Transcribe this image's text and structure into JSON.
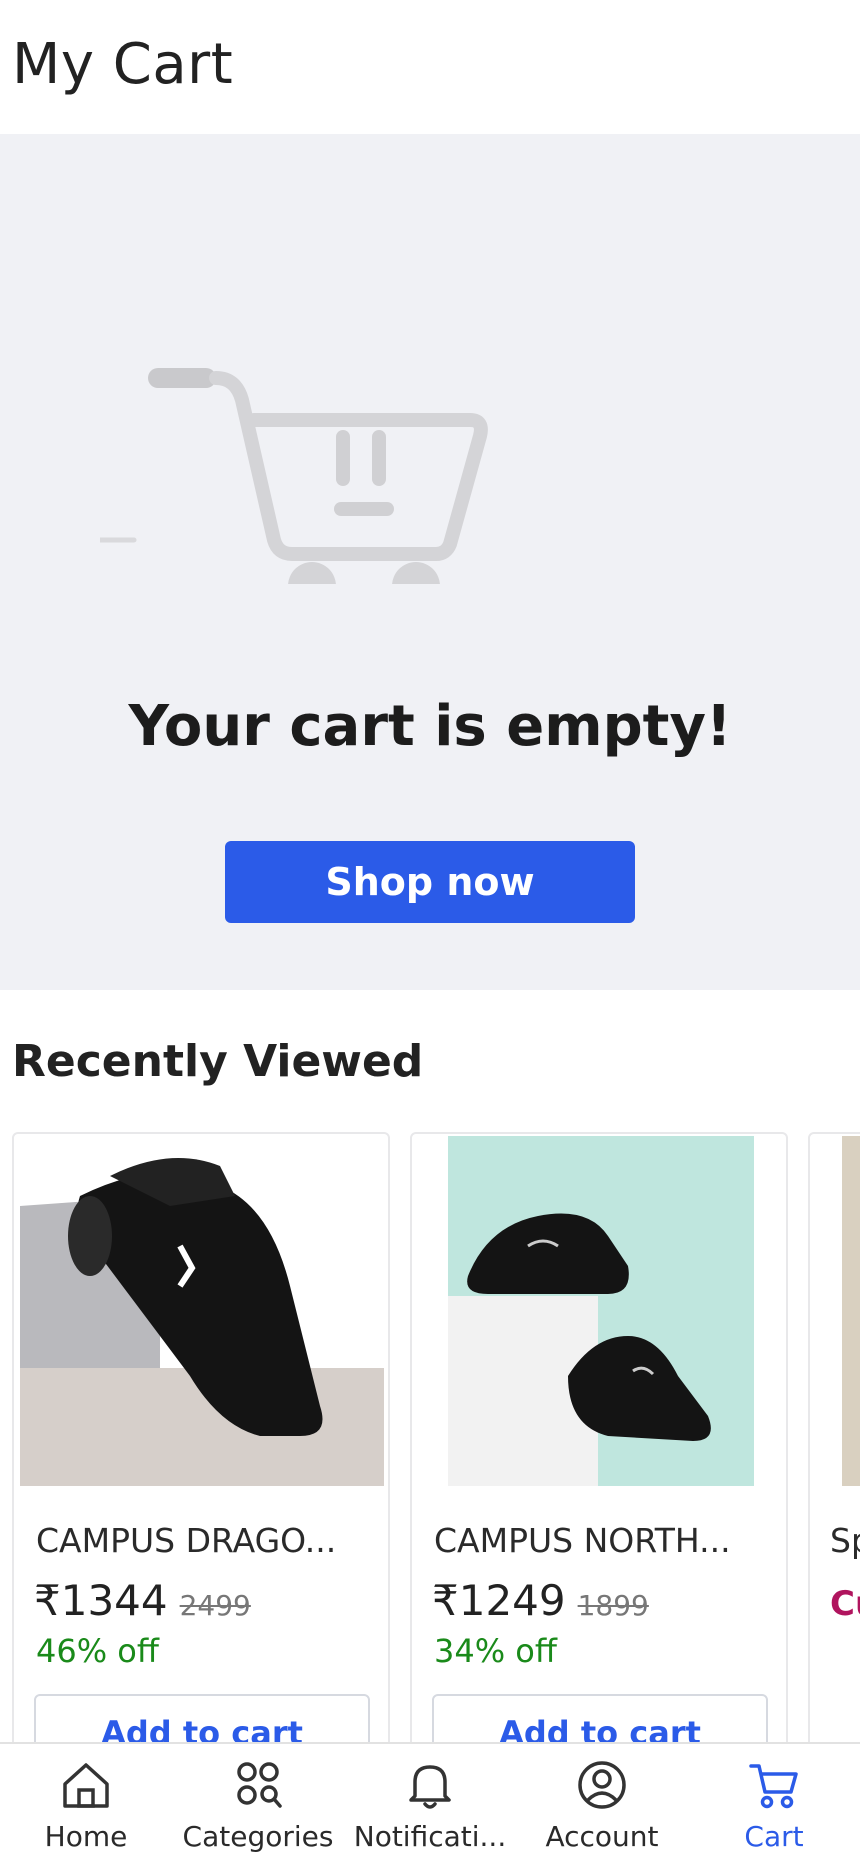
{
  "header": {
    "title": "My Cart"
  },
  "empty_state": {
    "message": "Your cart is empty!",
    "button_label": "Shop now"
  },
  "recent": {
    "title": "Recently Viewed",
    "items": [
      {
        "name": "CAMPUS DRAGO...",
        "price": "₹1344",
        "mrp": "2499",
        "discount": "46% off",
        "add_label": "Add to cart"
      },
      {
        "name": "CAMPUS NORTH...",
        "price": "₹1249",
        "mrp": "1899",
        "discount": "34% off",
        "add_label": "Add to cart"
      },
      {
        "name": "Sp",
        "promo": "Cu un"
      }
    ]
  },
  "bottom_nav": [
    {
      "label": "Home",
      "icon": "home-icon"
    },
    {
      "label": "Categories",
      "icon": "categories-icon"
    },
    {
      "label": "Notificati...",
      "icon": "bell-icon"
    },
    {
      "label": "Account",
      "icon": "account-icon"
    },
    {
      "label": "Cart",
      "icon": "cart-icon",
      "active": true
    }
  ],
  "colors": {
    "accent": "#2b5be8",
    "discount": "#1a8a1a",
    "promo": "#b0145e",
    "empty_bg": "#f0f1f5"
  }
}
